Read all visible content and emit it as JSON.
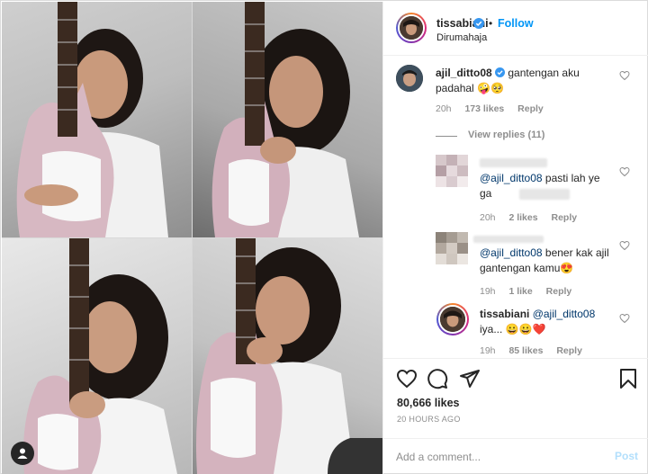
{
  "post": {
    "username": "tissabiani",
    "location": "Dirumahaja",
    "follow_label": "Follow",
    "dot": "•"
  },
  "comments": [
    {
      "username": "ajil_ditto08",
      "text": "gantengan aku padahal 🤪🥺",
      "time": "20h",
      "likes": "173 likes",
      "reply": "Reply",
      "view_replies": "View replies (11)"
    },
    {
      "username": "",
      "mention": "@ajil_ditto08",
      "text": "pasti lah ye ga",
      "time": "20h",
      "likes": "2 likes",
      "reply": "Reply"
    },
    {
      "username": "",
      "mention": "@ajil_ditto08",
      "text": "bener kak ajil gantengan kamu😍",
      "time": "19h",
      "likes": "1 like",
      "reply": "Reply"
    },
    {
      "username": "tissabiani",
      "mention": "@ajil_ditto08",
      "text": "iya... 😀😀❤️",
      "time": "19h",
      "likes": "85 likes",
      "reply": "Reply"
    }
  ],
  "actions": {
    "likes": "80,666 likes",
    "date": "20 HOURS AGO"
  },
  "add_comment": {
    "placeholder": "Add a comment...",
    "post_label": "Post"
  },
  "colors": {
    "accent": "#0095f6",
    "muted": "#8e8e8e",
    "mention": "#00376b",
    "post_disabled": "#b2dffc"
  }
}
